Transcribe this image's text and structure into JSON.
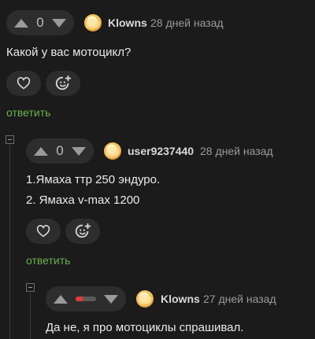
{
  "comments": [
    {
      "vote_count": "0",
      "author": "Klowns",
      "time": "28 дней назад",
      "lines": [
        "Какой у вас мотоцикл?"
      ],
      "reply_label": "ответить"
    },
    {
      "vote_count": "0",
      "author": "user9237440",
      "time": "28 дней назад",
      "lines": [
        "1.Ямаха ттр 250 эндуро.",
        "2. Ямаха v-max 1200"
      ],
      "reply_label": "ответить"
    },
    {
      "author": "Klowns",
      "time": "27 дней назад",
      "lines": [
        "Да не, я про мотоциклы спрашивал."
      ]
    }
  ],
  "icons": {
    "upvote": "triangle-up-icon",
    "downvote": "triangle-down-icon",
    "like": "heart-icon",
    "react": "smiley-add-icon",
    "collapse": "collapse-minus-icon"
  },
  "colors": {
    "background": "#1b1b1b",
    "pill": "#2d2d2d",
    "reply": "#68b24b",
    "negative": "#e03a3a"
  }
}
